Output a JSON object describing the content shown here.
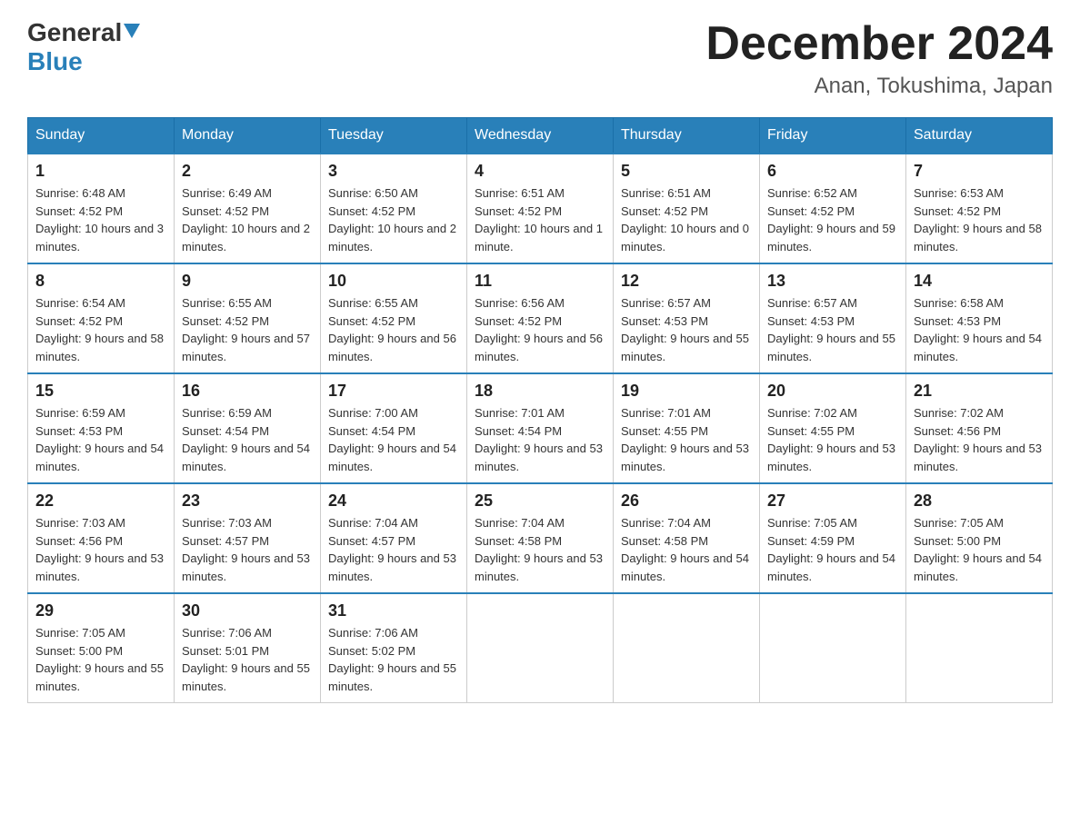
{
  "header": {
    "logo_general": "General",
    "logo_blue": "Blue",
    "title": "December 2024",
    "subtitle": "Anan, Tokushima, Japan"
  },
  "days_of_week": [
    "Sunday",
    "Monday",
    "Tuesday",
    "Wednesday",
    "Thursday",
    "Friday",
    "Saturday"
  ],
  "weeks": [
    [
      {
        "day": "1",
        "sunrise": "6:48 AM",
        "sunset": "4:52 PM",
        "daylight": "10 hours and 3 minutes."
      },
      {
        "day": "2",
        "sunrise": "6:49 AM",
        "sunset": "4:52 PM",
        "daylight": "10 hours and 2 minutes."
      },
      {
        "day": "3",
        "sunrise": "6:50 AM",
        "sunset": "4:52 PM",
        "daylight": "10 hours and 2 minutes."
      },
      {
        "day": "4",
        "sunrise": "6:51 AM",
        "sunset": "4:52 PM",
        "daylight": "10 hours and 1 minute."
      },
      {
        "day": "5",
        "sunrise": "6:51 AM",
        "sunset": "4:52 PM",
        "daylight": "10 hours and 0 minutes."
      },
      {
        "day": "6",
        "sunrise": "6:52 AM",
        "sunset": "4:52 PM",
        "daylight": "9 hours and 59 minutes."
      },
      {
        "day": "7",
        "sunrise": "6:53 AM",
        "sunset": "4:52 PM",
        "daylight": "9 hours and 58 minutes."
      }
    ],
    [
      {
        "day": "8",
        "sunrise": "6:54 AM",
        "sunset": "4:52 PM",
        "daylight": "9 hours and 58 minutes."
      },
      {
        "day": "9",
        "sunrise": "6:55 AM",
        "sunset": "4:52 PM",
        "daylight": "9 hours and 57 minutes."
      },
      {
        "day": "10",
        "sunrise": "6:55 AM",
        "sunset": "4:52 PM",
        "daylight": "9 hours and 56 minutes."
      },
      {
        "day": "11",
        "sunrise": "6:56 AM",
        "sunset": "4:52 PM",
        "daylight": "9 hours and 56 minutes."
      },
      {
        "day": "12",
        "sunrise": "6:57 AM",
        "sunset": "4:53 PM",
        "daylight": "9 hours and 55 minutes."
      },
      {
        "day": "13",
        "sunrise": "6:57 AM",
        "sunset": "4:53 PM",
        "daylight": "9 hours and 55 minutes."
      },
      {
        "day": "14",
        "sunrise": "6:58 AM",
        "sunset": "4:53 PM",
        "daylight": "9 hours and 54 minutes."
      }
    ],
    [
      {
        "day": "15",
        "sunrise": "6:59 AM",
        "sunset": "4:53 PM",
        "daylight": "9 hours and 54 minutes."
      },
      {
        "day": "16",
        "sunrise": "6:59 AM",
        "sunset": "4:54 PM",
        "daylight": "9 hours and 54 minutes."
      },
      {
        "day": "17",
        "sunrise": "7:00 AM",
        "sunset": "4:54 PM",
        "daylight": "9 hours and 54 minutes."
      },
      {
        "day": "18",
        "sunrise": "7:01 AM",
        "sunset": "4:54 PM",
        "daylight": "9 hours and 53 minutes."
      },
      {
        "day": "19",
        "sunrise": "7:01 AM",
        "sunset": "4:55 PM",
        "daylight": "9 hours and 53 minutes."
      },
      {
        "day": "20",
        "sunrise": "7:02 AM",
        "sunset": "4:55 PM",
        "daylight": "9 hours and 53 minutes."
      },
      {
        "day": "21",
        "sunrise": "7:02 AM",
        "sunset": "4:56 PM",
        "daylight": "9 hours and 53 minutes."
      }
    ],
    [
      {
        "day": "22",
        "sunrise": "7:03 AM",
        "sunset": "4:56 PM",
        "daylight": "9 hours and 53 minutes."
      },
      {
        "day": "23",
        "sunrise": "7:03 AM",
        "sunset": "4:57 PM",
        "daylight": "9 hours and 53 minutes."
      },
      {
        "day": "24",
        "sunrise": "7:04 AM",
        "sunset": "4:57 PM",
        "daylight": "9 hours and 53 minutes."
      },
      {
        "day": "25",
        "sunrise": "7:04 AM",
        "sunset": "4:58 PM",
        "daylight": "9 hours and 53 minutes."
      },
      {
        "day": "26",
        "sunrise": "7:04 AM",
        "sunset": "4:58 PM",
        "daylight": "9 hours and 54 minutes."
      },
      {
        "day": "27",
        "sunrise": "7:05 AM",
        "sunset": "4:59 PM",
        "daylight": "9 hours and 54 minutes."
      },
      {
        "day": "28",
        "sunrise": "7:05 AM",
        "sunset": "5:00 PM",
        "daylight": "9 hours and 54 minutes."
      }
    ],
    [
      {
        "day": "29",
        "sunrise": "7:05 AM",
        "sunset": "5:00 PM",
        "daylight": "9 hours and 55 minutes."
      },
      {
        "day": "30",
        "sunrise": "7:06 AM",
        "sunset": "5:01 PM",
        "daylight": "9 hours and 55 minutes."
      },
      {
        "day": "31",
        "sunrise": "7:06 AM",
        "sunset": "5:02 PM",
        "daylight": "9 hours and 55 minutes."
      },
      null,
      null,
      null,
      null
    ]
  ],
  "labels": {
    "sunrise": "Sunrise:",
    "sunset": "Sunset:",
    "daylight": "Daylight:"
  }
}
